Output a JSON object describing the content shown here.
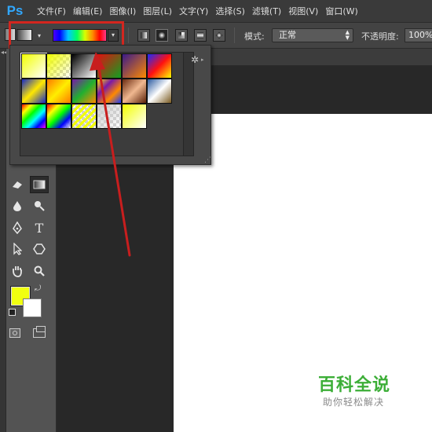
{
  "app": {
    "logo": "Ps",
    "accent": "#31a8ff"
  },
  "menu": {
    "items": [
      "文件(F)",
      "编辑(E)",
      "图像(I)",
      "图层(L)",
      "文字(Y)",
      "选择(S)",
      "滤镜(T)",
      "视图(V)",
      "窗口(W)"
    ]
  },
  "options": {
    "mode_label": "模式:",
    "mode_value": "正常",
    "opacity_label": "不透明度:",
    "opacity_value": "100%",
    "gradient_types": [
      "linear-gradient-icon",
      "radial-gradient-icon",
      "angle-gradient-icon",
      "reflected-gradient-icon",
      "diamond-gradient-icon"
    ],
    "highlight_color": "#d3261f"
  },
  "gradient_picker": {
    "presets": [
      {
        "name": "foreground-to-background",
        "colors": [
          "#f2ff00",
          "#ffffff"
        ]
      },
      {
        "name": "foreground-to-transparent",
        "colors": [
          "#f2ff00",
          "transparent"
        ]
      },
      {
        "name": "black-white",
        "colors": [
          "#000000",
          "#ffffff"
        ]
      },
      {
        "name": "red-green",
        "colors": [
          "#e01010",
          "#10a020"
        ]
      },
      {
        "name": "violet-orange",
        "colors": [
          "#3a1a8a",
          "#ff8a00"
        ]
      },
      {
        "name": "blue-red-yellow",
        "colors": [
          "#1a2aff",
          "#ff1010",
          "#ffff00"
        ]
      },
      {
        "name": "blue-yellow-blue",
        "colors": [
          "#1428c8",
          "#ffe800",
          "#1428c8"
        ]
      },
      {
        "name": "orange-yellow-orange",
        "colors": [
          "#ff7a00",
          "#ffee00",
          "#ff7a00"
        ]
      },
      {
        "name": "violet-green-orange",
        "colors": [
          "#7a18a8",
          "#20b030",
          "#ff8a00"
        ]
      },
      {
        "name": "yellow-violet-orange-blue",
        "colors": [
          "#ffe800",
          "#7a18a8",
          "#ff8a00",
          "#1a3aff"
        ]
      },
      {
        "name": "copper",
        "colors": [
          "#6a2a10",
          "#f0b890",
          "#5a2008"
        ]
      },
      {
        "name": "chrome",
        "colors": [
          "#2a5aa0",
          "#ffffff",
          "#7a5a20"
        ]
      },
      {
        "name": "spectrum",
        "colors": [
          "#ff0000",
          "#ffff00",
          "#00ff00",
          "#00ffff",
          "#0000ff",
          "#ff00ff"
        ]
      },
      {
        "name": "transparent-rainbow",
        "colors": [
          "#ff0000",
          "#ffff00",
          "#00ff00",
          "#0000ff"
        ]
      },
      {
        "name": "transparent-stripes",
        "colors": [
          "#f2ff00",
          "#ffffff"
        ]
      },
      {
        "name": "neutral-transparent",
        "colors": [
          "#cccccc",
          "#ffffff"
        ]
      },
      {
        "name": "yellow-white",
        "colors": [
          "#f2ff00",
          "#ffffff"
        ]
      }
    ]
  },
  "toolbar": {
    "tools": [
      "gradient-tool-icon",
      "eraser-tool-icon",
      "blur-tool-icon",
      "dodge-tool-icon",
      "pen-tool-icon",
      "type-tool-icon",
      "path-selection-icon",
      "shape-tool-icon",
      "hand-tool-icon",
      "zoom-tool-icon",
      "quick-mask-icon",
      "screen-mode-icon"
    ],
    "type_tool_glyph": "T",
    "foreground_color": "#f0ff10",
    "background_color": "#ffffff"
  },
  "watermark": {
    "title": "百科全说",
    "subtitle": "助你轻松解决",
    "color": "#3cae37"
  }
}
